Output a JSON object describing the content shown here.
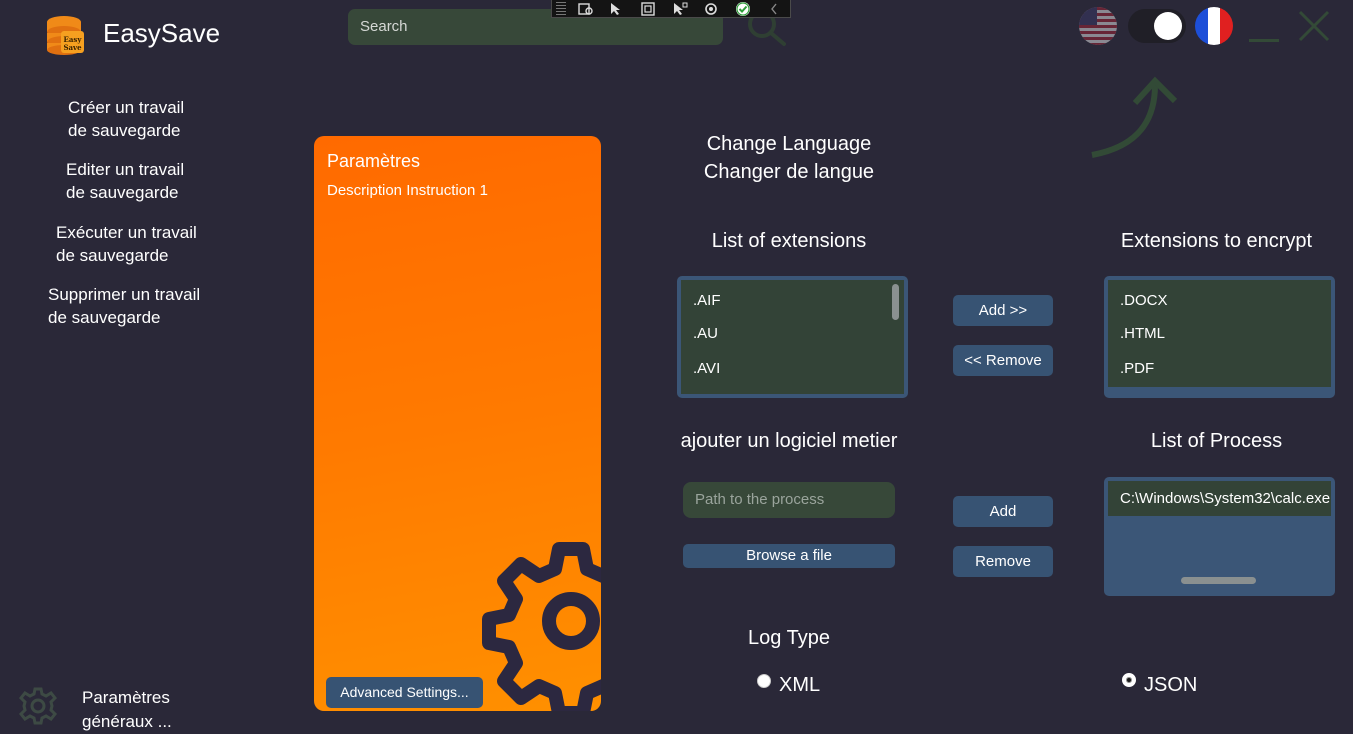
{
  "app": {
    "title": "EasySave",
    "logo_text": "Easy Save"
  },
  "search": {
    "placeholder": "Search"
  },
  "header": {
    "flags": [
      "us-flag-icon",
      "fr-flag-icon"
    ],
    "theme_toggle": "on"
  },
  "sidebar": {
    "items": [
      {
        "line1": "Créer un travail",
        "line2": "de sauvegarde"
      },
      {
        "line1": "Editer un travail",
        "line2": "de sauvegarde"
      },
      {
        "line1": "Exécuter un travail",
        "line2": "de sauvegarde"
      },
      {
        "line1": "Supprimer un travail",
        "line2": "de sauvegarde"
      }
    ],
    "settings": {
      "line1": "Paramètres",
      "line2": "généraux ..."
    }
  },
  "card": {
    "title": "Paramètres",
    "description": "Description Instruction 1",
    "advanced_button": "Advanced Settings..."
  },
  "language": {
    "line1": "Change Language",
    "line2": "Changer de langue"
  },
  "extensions": {
    "heading": "List of extensions",
    "items": [
      ".AIF",
      ".AU",
      ".AVI"
    ],
    "add_button": "Add >>",
    "remove_button": "<< Remove"
  },
  "encrypt": {
    "heading": "Extensions to encrypt",
    "items": [
      ".DOCX",
      ".HTML",
      ".PDF"
    ]
  },
  "business_software": {
    "heading": "ajouter un logiciel metier",
    "path_placeholder": "Path to the process",
    "browse_button": "Browse a file",
    "add_button": "Add",
    "remove_button": "Remove"
  },
  "process": {
    "heading": "List of Process",
    "items": [
      "C:\\Windows\\System32\\calc.exe"
    ]
  },
  "log": {
    "heading": "Log Type",
    "options": [
      "XML",
      "JSON"
    ],
    "selected": "JSON"
  },
  "colors": {
    "background": "#2a2838",
    "accent_orange": "#ff7a00",
    "button_blue": "#375373",
    "input_green": "#374839"
  }
}
